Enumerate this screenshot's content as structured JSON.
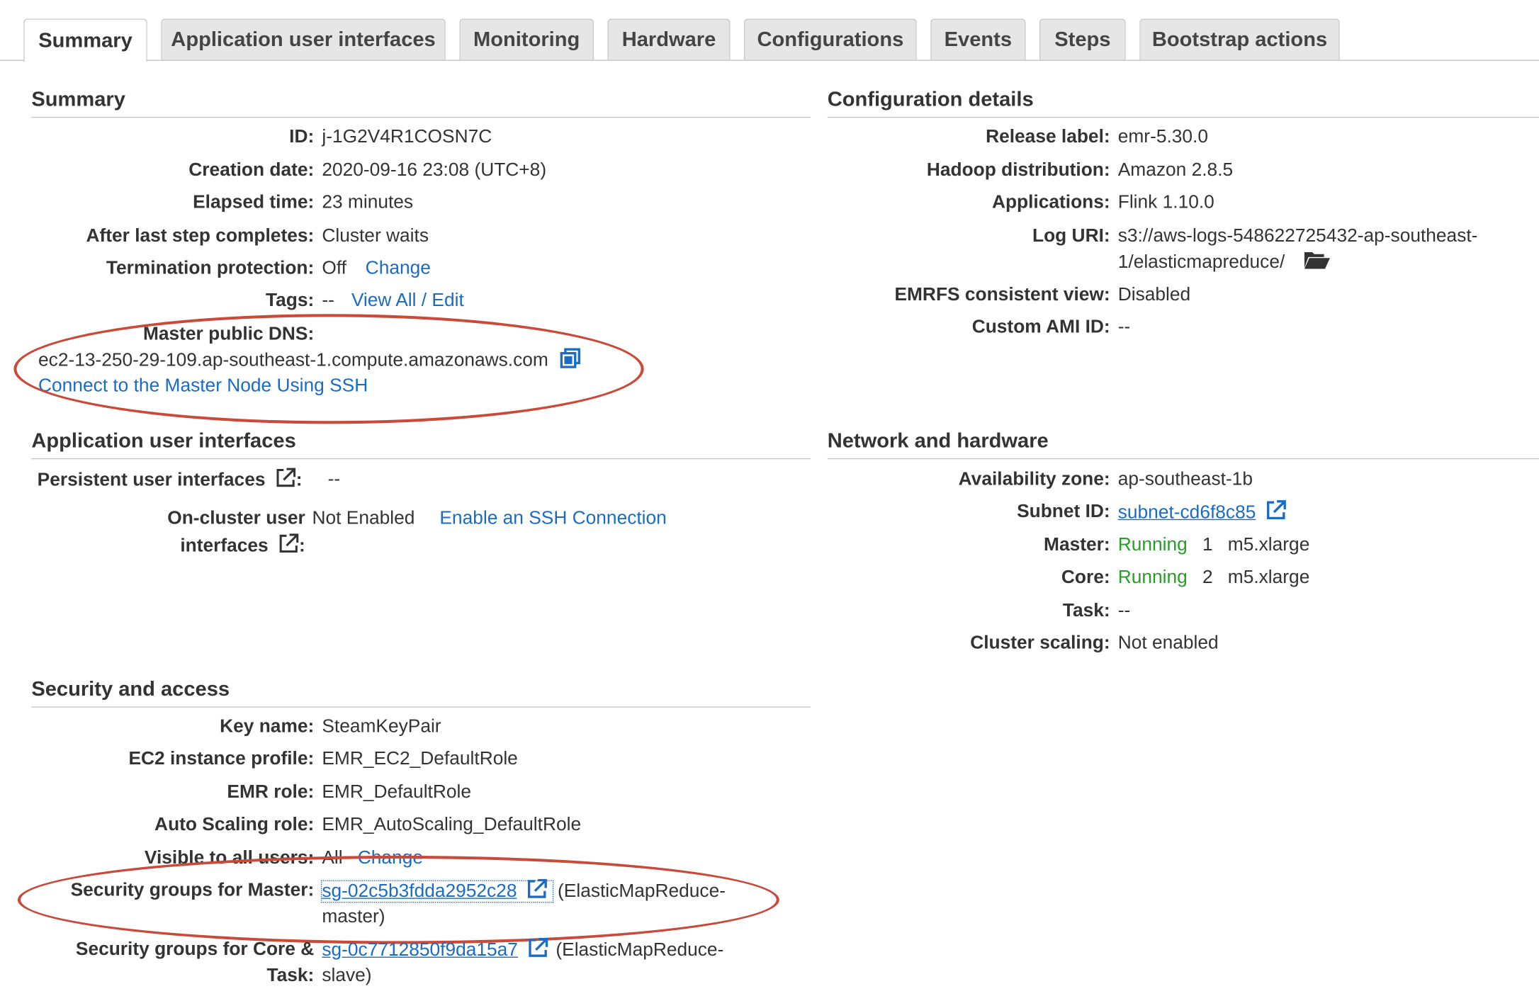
{
  "tabs": [
    {
      "label": "Summary",
      "active": true
    },
    {
      "label": "Application user interfaces"
    },
    {
      "label": "Monitoring"
    },
    {
      "label": "Hardware"
    },
    {
      "label": "Configurations"
    },
    {
      "label": "Events"
    },
    {
      "label": "Steps"
    },
    {
      "label": "Bootstrap actions"
    }
  ],
  "summary": {
    "title": "Summary",
    "id_label": "ID:",
    "id_value": "j-1G2V4R1COSN7C",
    "creation_label": "Creation date:",
    "creation_value": "2020-09-16 23:08 (UTC+8)",
    "elapsed_label": "Elapsed time:",
    "elapsed_value": "23 minutes",
    "after_step_label": "After last step completes:",
    "after_step_value": "Cluster waits",
    "termination_label": "Termination protection:",
    "termination_value": "Off",
    "termination_link": "Change",
    "tags_label": "Tags:",
    "tags_value": "--",
    "tags_link": "View All / Edit",
    "master_dns_label": "Master public DNS:",
    "master_dns_value": "ec2-13-250-29-109.ap-southeast-1.compute.amazonaws.com",
    "ssh_link": "Connect to the Master Node Using SSH"
  },
  "config": {
    "title": "Configuration details",
    "release_label": "Release label:",
    "release_value": "emr-5.30.0",
    "hadoop_label": "Hadoop distribution:",
    "hadoop_value": "Amazon 2.8.5",
    "apps_label": "Applications:",
    "apps_value": "Flink 1.10.0",
    "log_label": "Log URI:",
    "log_value_line1": "s3://aws-logs-548622725432-ap-southeast-",
    "log_value_line2": "1/elasticmapreduce/",
    "emrfs_label": "EMRFS consistent view:",
    "emrfs_value": "Disabled",
    "ami_label": "Custom AMI ID:",
    "ami_value": "--"
  },
  "app_ui": {
    "title": "Application user interfaces",
    "persistent_label": "Persistent user interfaces",
    "persistent_colon": ":",
    "persistent_value": "--",
    "oncluster_label_line1": "On-cluster user",
    "oncluster_label_line2": "interfaces",
    "oncluster_colon": ":",
    "oncluster_value": "Not Enabled",
    "oncluster_link": "Enable an SSH Connection"
  },
  "network": {
    "title": "Network and hardware",
    "az_label": "Availability zone:",
    "az_value": "ap-southeast-1b",
    "subnet_label": "Subnet ID:",
    "subnet_value": "subnet-cd6f8c85",
    "master_label": "Master:",
    "master_status": "Running",
    "master_count": "1",
    "master_type": "m5.xlarge",
    "core_label": "Core:",
    "core_status": "Running",
    "core_count": "2",
    "core_type": "m5.xlarge",
    "task_label": "Task:",
    "task_value": "--",
    "scaling_label": "Cluster scaling:",
    "scaling_value": "Not enabled"
  },
  "security": {
    "title": "Security and access",
    "key_label": "Key name:",
    "key_value": "SteamKeyPair",
    "profile_label": "EC2 instance profile:",
    "profile_value": "EMR_EC2_DefaultRole",
    "emr_role_label": "EMR role:",
    "emr_role_value": "EMR_DefaultRole",
    "autoscale_label": "Auto Scaling role:",
    "autoscale_value": "EMR_AutoScaling_DefaultRole",
    "visible_label": "Visible to all users:",
    "visible_value": "All",
    "visible_link": "Change",
    "sg_master_label": "Security groups for Master:",
    "sg_master_link": "sg-02c5b3fdda2952c28",
    "sg_master_desc_line1": "(ElasticMapReduce-",
    "sg_master_desc_line2": "master)",
    "sg_core_label_line1": "Security groups for Core &",
    "sg_core_label_line2": "Task:",
    "sg_core_link": "sg-0c7712850f9da15a7",
    "sg_core_desc_line1": "(ElasticMapReduce-",
    "sg_core_desc_line2": "slave)"
  },
  "annotations": {
    "highlight_color": "#c94a3a"
  },
  "icons": [
    "copy-icon",
    "external-link-icon",
    "folder-open-icon"
  ]
}
